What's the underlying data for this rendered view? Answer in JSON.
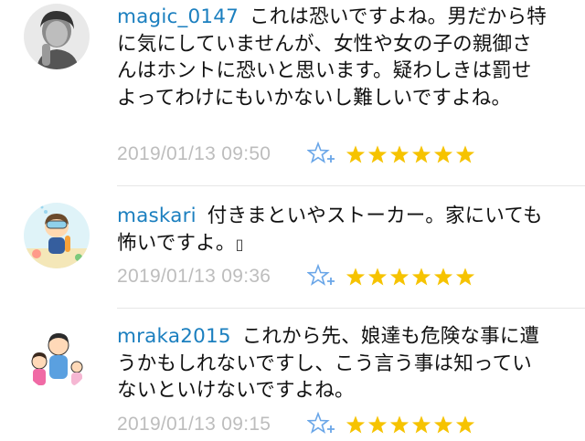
{
  "colors": {
    "username": "#1b7fbf",
    "timestamp": "#bdbdbd",
    "star_filled": "#f6c300",
    "star_add": "#6aa6e8"
  },
  "comments": [
    {
      "username": "magic_0147",
      "text": "これは恐いですよね。男だから特に気にしていませんが、女性や女の子の親御さんはホントに恐いと思います。疑わしきは罰せよってわけにもいかないし難しいですよね。",
      "timestamp": "2019/01/13 09:50",
      "star_count": 6,
      "avatar": "man-portrait-avatar"
    },
    {
      "username": "maskari",
      "text": "付きまといやストーカー。家にいても怖いですよ。",
      "trailing_symbol": "▯",
      "timestamp": "2019/01/13 09:36",
      "star_count": 6,
      "avatar": "diver-avatar"
    },
    {
      "username": "mraka2015",
      "text": "これから先、娘達も危険な事に遭うかもしれないですし、こう言う事は知っていないといけないですよね。",
      "timestamp": "2019/01/13 09:15",
      "star_count": 6,
      "avatar": "family-avatar"
    }
  ]
}
